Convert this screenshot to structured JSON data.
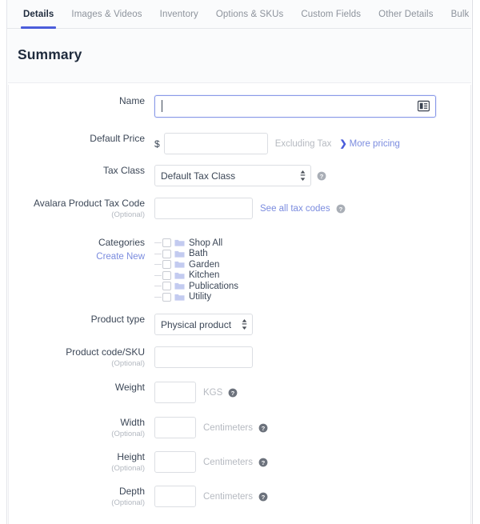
{
  "tabs": [
    {
      "label": "Details",
      "active": true
    },
    {
      "label": "Images & Videos",
      "active": false
    },
    {
      "label": "Inventory",
      "active": false
    },
    {
      "label": "Options & SKUs",
      "active": false
    },
    {
      "label": "Custom Fields",
      "active": false
    },
    {
      "label": "Other Details",
      "active": false
    },
    {
      "label": "Bulk Pricing",
      "active": false
    }
  ],
  "section": {
    "title": "Summary"
  },
  "colors": {
    "accent": "#4b5ddb",
    "link": "#7b8cdf",
    "focus_border": "#8a9ae8",
    "text": "#3c4757",
    "muted": "#b6bac1",
    "folder": "#c3cbf0"
  },
  "fields": {
    "name": {
      "label": "Name",
      "value": "",
      "placeholder": "",
      "icon": "form-card-icon",
      "focused": true
    },
    "default_price": {
      "label": "Default Price",
      "currency_symbol": "$",
      "value": "",
      "placeholder": "",
      "note": "Excluding Tax",
      "more_link": "More pricing",
      "more_chevron": "❯"
    },
    "tax_class": {
      "label": "Tax Class",
      "selected": "Default Tax Class",
      "options": [
        "Default Tax Class"
      ],
      "help": "help-icon"
    },
    "avalara_tax_code": {
      "label": "Avalara Product Tax Code",
      "optional": "(Optional)",
      "value": "",
      "placeholder": "",
      "link": "See all tax codes",
      "help": "help-icon"
    },
    "categories": {
      "label": "Categories",
      "create_new": "Create New",
      "items": [
        {
          "label": "Shop All",
          "checked": false
        },
        {
          "label": "Bath",
          "checked": false
        },
        {
          "label": "Garden",
          "checked": false
        },
        {
          "label": "Kitchen",
          "checked": false
        },
        {
          "label": "Publications",
          "checked": false
        },
        {
          "label": "Utility",
          "checked": false
        }
      ]
    },
    "product_type": {
      "label": "Product type",
      "selected": "Physical product",
      "options": [
        "Physical product"
      ]
    },
    "product_code": {
      "label": "Product code/SKU",
      "optional": "(Optional)",
      "value": "",
      "placeholder": ""
    },
    "weight": {
      "label": "Weight",
      "value": "",
      "placeholder": "",
      "unit": "KGS",
      "help": "help-icon"
    },
    "width": {
      "label": "Width",
      "optional": "(Optional)",
      "value": "",
      "placeholder": "",
      "unit": "Centimeters",
      "help": "help-icon"
    },
    "height": {
      "label": "Height",
      "optional": "(Optional)",
      "value": "",
      "placeholder": "",
      "unit": "Centimeters",
      "help": "help-icon"
    },
    "depth": {
      "label": "Depth",
      "optional": "(Optional)",
      "value": "",
      "placeholder": "",
      "unit": "Centimeters",
      "help": "help-icon"
    }
  }
}
